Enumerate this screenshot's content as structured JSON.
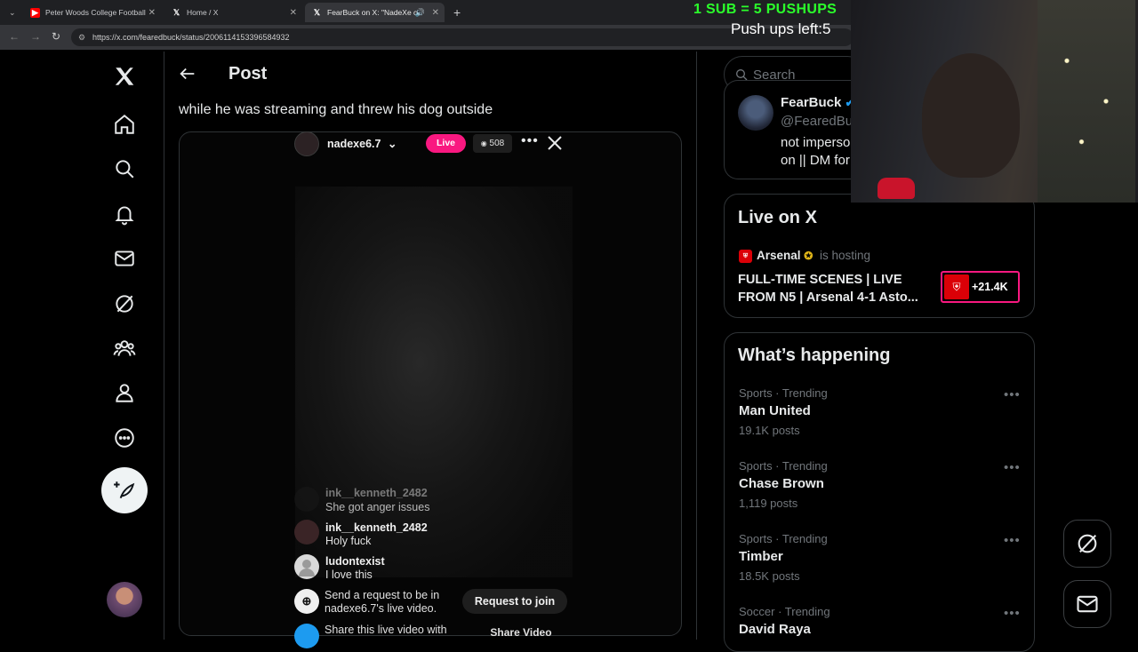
{
  "browser": {
    "tabs": [
      {
        "title": "Peter Woods College Football"
      },
      {
        "title": "Home / X"
      },
      {
        "title": "FearBuck on X: \"NadeXe cr"
      }
    ],
    "url": "https://x.com/fearedbuck/status/2006114153396584932"
  },
  "overlay": {
    "banner": "1 SUB = 5 PUSHUPS",
    "pushups_left": "Push ups left:5"
  },
  "header": {
    "title": "Post"
  },
  "tweet": {
    "text": "while he was streaming and threw his dog outside"
  },
  "stream": {
    "streamer": "nadexe6.7",
    "live_label": "Live",
    "viewers": "508",
    "chat": [
      {
        "user": "ink__kenneth_2482",
        "message": "She got anger issues"
      },
      {
        "user": "ink__kenneth_2482",
        "message": "Holy fuck"
      },
      {
        "user": "ludontexist",
        "message": "I love this"
      }
    ],
    "request_text_line1": "Send a request to be in",
    "request_text_line2": "nadexe6.7's live video.",
    "request_button": "Request to join",
    "share_text": "Share this live video with",
    "share_button": "Share Video"
  },
  "right": {
    "search_placeholder": "Search",
    "profile": {
      "name": "FearBuck",
      "handle": "@FearedBu",
      "bio_line1": "not imperso",
      "bio_line2": "on || DM for"
    },
    "live": {
      "title": "Live on X",
      "host": "Arsenal",
      "hosting_label": "is hosting",
      "stream_title_line1": "FULL-TIME SCENES | LIVE",
      "stream_title_line2": "FROM N5 | Arsenal 4-1 Asto...",
      "count": "+21.4K"
    },
    "happening": {
      "title": "What’s happening",
      "trends": [
        {
          "category": "Sports · Trending",
          "name": "Man United",
          "posts": "19.1K posts"
        },
        {
          "category": "Sports · Trending",
          "name": "Chase Brown",
          "posts": "1,119 posts"
        },
        {
          "category": "Sports · Trending",
          "name": "Timber",
          "posts": "18.5K posts"
        },
        {
          "category": "Soccer · Trending",
          "name": "David Raya",
          "posts": ""
        }
      ]
    }
  },
  "colors": {
    "accent_pink": "#f91880",
    "banner_green": "#2bff2b",
    "arsenal_red": "#db0007"
  }
}
